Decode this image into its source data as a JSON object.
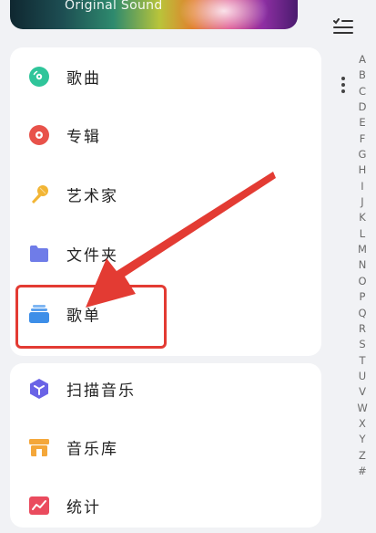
{
  "banner": {
    "title": "Original Sound"
  },
  "nav": {
    "items": [
      {
        "label": "歌曲",
        "icon": "song-disc-icon"
      },
      {
        "label": "专辑",
        "icon": "album-disc-icon"
      },
      {
        "label": "艺术家",
        "icon": "microphone-icon"
      },
      {
        "label": "文件夹",
        "icon": "folder-icon"
      },
      {
        "label": "歌单",
        "icon": "playlist-stack-icon"
      }
    ],
    "secondary": [
      {
        "label": "扫描音乐",
        "icon": "scan-cube-icon"
      },
      {
        "label": "音乐库",
        "icon": "music-library-icon"
      },
      {
        "label": "统计",
        "icon": "stats-chart-icon"
      }
    ]
  },
  "alphabet": [
    "A",
    "B",
    "C",
    "D",
    "E",
    "F",
    "G",
    "H",
    "I",
    "J",
    "K",
    "L",
    "M",
    "N",
    "O",
    "P",
    "Q",
    "R",
    "S",
    "T",
    "U",
    "V",
    "W",
    "X",
    "Y",
    "Z",
    "#"
  ],
  "colors": {
    "song": "#2fc59a",
    "album": "#e8524a",
    "artist": "#f2b535",
    "folder": "#6f7ce8",
    "playlist": "#3d8ee8",
    "scan": "#6a63e6",
    "library": "#f4a73a",
    "stats": "#ea4b5e",
    "annotation": "#e33b33"
  }
}
